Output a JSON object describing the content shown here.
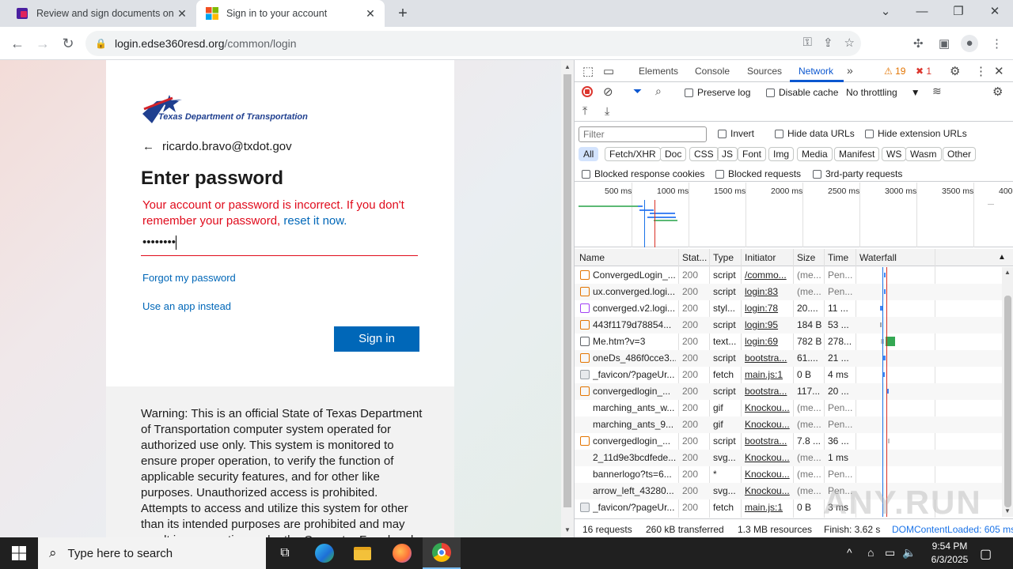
{
  "browser": {
    "tabs": [
      {
        "title": "Review and sign documents on D",
        "active": false
      },
      {
        "title": "Sign in to your account",
        "active": true
      }
    ],
    "url_host": "login.edse360resd.org",
    "url_path": "/common/login"
  },
  "login": {
    "org_logo_text": "Texas Department of Transportation",
    "email": "ricardo.bravo@txdot.gov",
    "heading": "Enter password",
    "error_text": "Your account or password is incorrect. If you don't remember your password,",
    "error_link": "reset it now.",
    "password_mask": "••••••••",
    "forgot_link": "Forgot my password",
    "app_link": "Use an app instead",
    "signin_button": "Sign in",
    "warning": "Warning: This is an official State of Texas Department of Transportation computer system operated for authorized use only. This system is monitored to ensure proper operation, to verify the function of applicable security features, and for other like purposes. Unauthorized access is prohibited. Attempts to access and utilize this system for other than its intended purposes are prohibited and may result in prosecution under the Computer Fraud and"
  },
  "devtools": {
    "tabs": [
      "Elements",
      "Console",
      "Sources",
      "Network"
    ],
    "selected_tab": "Network",
    "warnings": "19",
    "errors": "1",
    "preserve_log": "Preserve log",
    "disable_cache": "Disable cache",
    "throttling": "No throttling",
    "filter_placeholder": "Filter",
    "invert": "Invert",
    "hide_data_urls": "Hide data URLs",
    "hide_ext_urls": "Hide extension URLs",
    "type_filters": [
      "All",
      "Fetch/XHR",
      "Doc",
      "CSS",
      "JS",
      "Font",
      "Img",
      "Media",
      "Manifest",
      "WS",
      "Wasm",
      "Other"
    ],
    "blocked_cookies": "Blocked response cookies",
    "blocked_requests": "Blocked requests",
    "third_party": "3rd-party requests",
    "timeline_ticks": [
      "500 ms",
      "1000 ms",
      "1500 ms",
      "2000 ms",
      "2500 ms",
      "3000 ms",
      "3500 ms",
      "400"
    ],
    "columns": [
      "Name",
      "Stat...",
      "Type",
      "Initiator",
      "Size",
      "Time",
      "Waterfall"
    ],
    "requests": [
      {
        "name": "ConvergedLogin_...",
        "status": "200",
        "type": "script",
        "initiator": "/commo...",
        "size": "(me...",
        "time": "Pen...",
        "icon": "script"
      },
      {
        "name": "ux.converged.logi...",
        "status": "200",
        "type": "script",
        "initiator": "login:83",
        "size": "(me...",
        "time": "Pen...",
        "icon": "script"
      },
      {
        "name": "converged.v2.logi...",
        "status": "200",
        "type": "styl...",
        "initiator": "login:78",
        "size": "20....",
        "time": "11 ...",
        "icon": "css"
      },
      {
        "name": "443f1179d78854...",
        "status": "200",
        "type": "script",
        "initiator": "login:95",
        "size": "184 B",
        "time": "53 ...",
        "icon": "script"
      },
      {
        "name": "Me.htm?v=3",
        "status": "200",
        "type": "text...",
        "initiator": "login:69",
        "size": "782 B",
        "time": "278...",
        "icon": "doc"
      },
      {
        "name": "oneDs_486f0cce3...",
        "status": "200",
        "type": "script",
        "initiator": "bootstra...",
        "size": "61....",
        "time": "21 ...",
        "icon": "script"
      },
      {
        "name": "_favicon/?pageUr...",
        "status": "200",
        "type": "fetch",
        "initiator": "main.js:1",
        "size": "0 B",
        "time": "4 ms",
        "icon": "img"
      },
      {
        "name": "convergedlogin_...",
        "status": "200",
        "type": "script",
        "initiator": "bootstra...",
        "size": "117...",
        "time": "20 ...",
        "icon": "script"
      },
      {
        "name": "marching_ants_w...",
        "status": "200",
        "type": "gif",
        "initiator": "Knockou...",
        "size": "(me...",
        "time": "Pen...",
        "icon": "none"
      },
      {
        "name": "marching_ants_9...",
        "status": "200",
        "type": "gif",
        "initiator": "Knockou...",
        "size": "(me...",
        "time": "Pen...",
        "icon": "none"
      },
      {
        "name": "convergedlogin_...",
        "status": "200",
        "type": "script",
        "initiator": "bootstra...",
        "size": "7.8 ...",
        "time": "36 ...",
        "icon": "script"
      },
      {
        "name": "2_11d9e3bcdfede...",
        "status": "200",
        "type": "svg...",
        "initiator": "Knockou...",
        "size": "(me...",
        "time": "1 ms",
        "icon": "none"
      },
      {
        "name": "bannerlogo?ts=6...",
        "status": "200",
        "type": "*",
        "initiator": "Knockou...",
        "size": "(me...",
        "time": "Pen...",
        "icon": "none"
      },
      {
        "name": "arrow_left_43280...",
        "status": "200",
        "type": "svg...",
        "initiator": "Knockou...",
        "size": "(me...",
        "time": "Pen...",
        "icon": "none"
      },
      {
        "name": "_favicon/?pageUr...",
        "status": "200",
        "type": "fetch",
        "initiator": "main.js:1",
        "size": "0 B",
        "time": "3 ms",
        "icon": "img"
      }
    ],
    "status": {
      "requests": "16 requests",
      "transferred": "260 kB transferred",
      "resources": "1.3 MB resources",
      "finish": "Finish: 3.62 s",
      "dcl": "DOMContentLoaded: 605 ms"
    }
  },
  "taskbar": {
    "search_placeholder": "Type here to search",
    "time": "9:54 PM",
    "date": "6/3/2025"
  },
  "watermark": "ANY.RUN",
  "colors": {
    "error": "#e00b1c",
    "ms_blue": "#0067b8",
    "devtools_accent": "#0b57d0"
  }
}
